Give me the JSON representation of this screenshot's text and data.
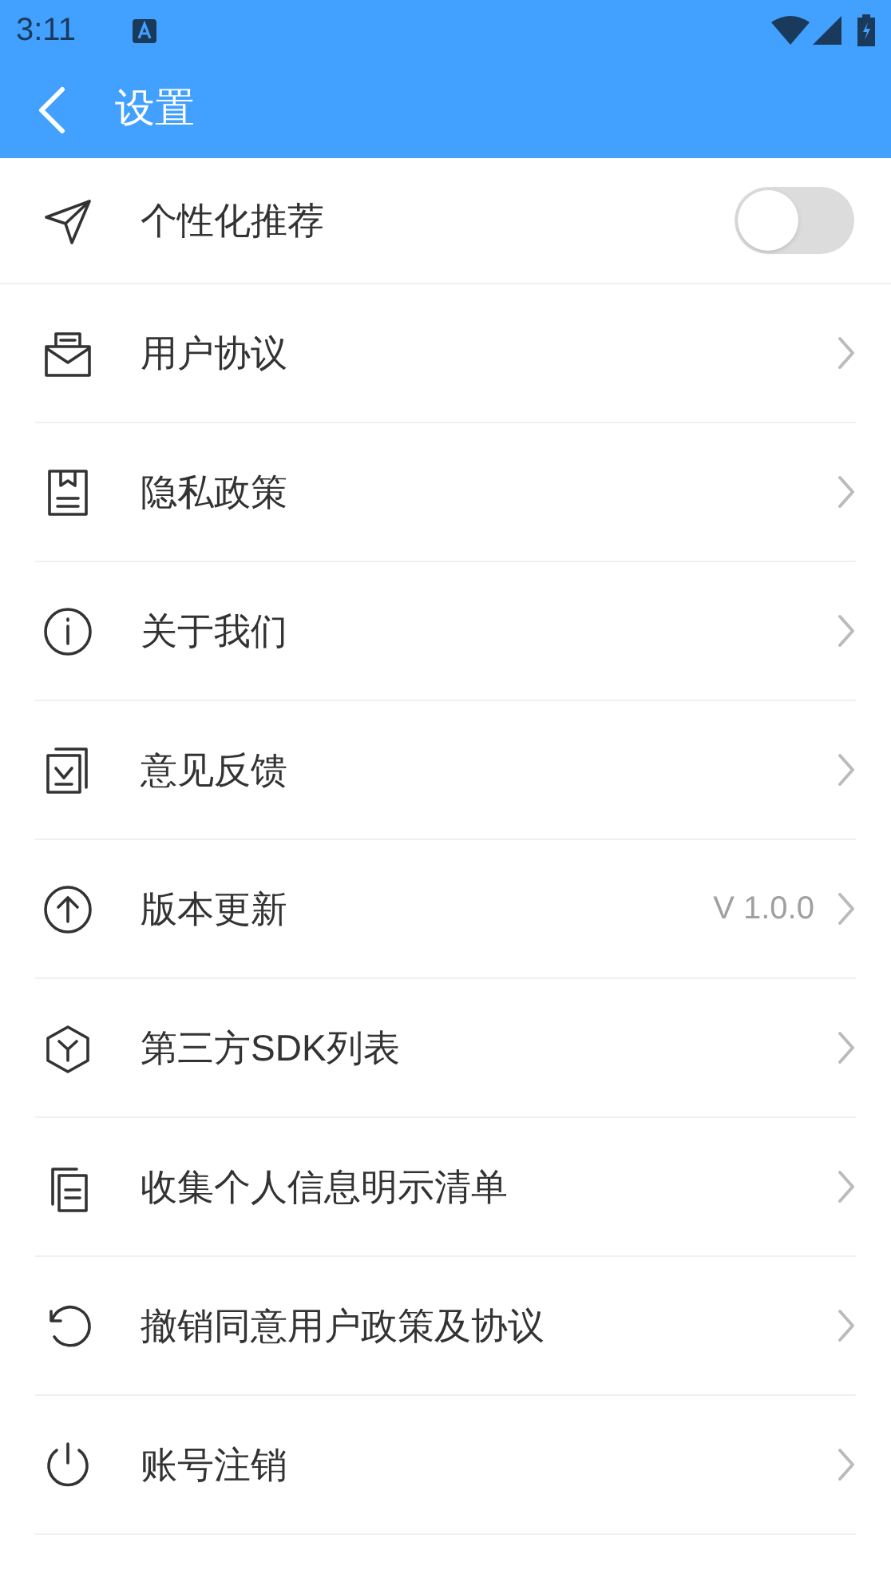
{
  "status_bar": {
    "time": "3:11"
  },
  "app_bar": {
    "title": "设置"
  },
  "items": [
    {
      "kind": "toggle",
      "label": "个性化推荐",
      "on": false
    },
    {
      "kind": "link",
      "label": "用户协议"
    },
    {
      "kind": "link",
      "label": "隐私政策"
    },
    {
      "kind": "link",
      "label": "关于我们"
    },
    {
      "kind": "link",
      "label": "意见反馈"
    },
    {
      "kind": "link",
      "label": "版本更新",
      "value": "V 1.0.0"
    },
    {
      "kind": "link",
      "label": "第三方SDK列表"
    },
    {
      "kind": "link",
      "label": "收集个人信息明示清单"
    },
    {
      "kind": "link",
      "label": "撤销同意用户政策及协议"
    },
    {
      "kind": "link",
      "label": "账号注销"
    }
  ]
}
